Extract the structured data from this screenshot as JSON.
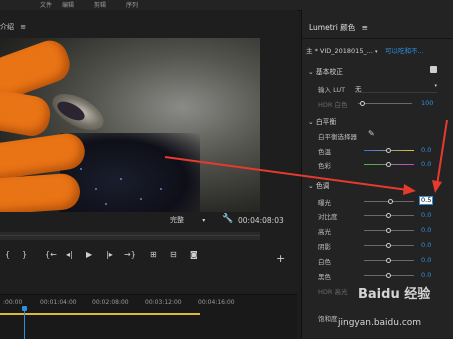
{
  "top_tabs": [
    "文件",
    "编辑",
    "剪辑",
    "序列"
  ],
  "left_panel": {
    "title": "介绍",
    "menu_icon": "hamburger-icon"
  },
  "monitor": {
    "fit_label": "完整",
    "timecode": "00:04:08:03",
    "transport_icons": [
      "mark-in-icon",
      "mark-out-icon",
      "go-to-in-icon",
      "step-back-icon",
      "play-icon",
      "step-forward-icon",
      "go-to-out-icon",
      "insert-icon",
      "overwrite-icon",
      "export-frame-icon"
    ],
    "add_icon": "plus-icon"
  },
  "timeline": {
    "ticks": [
      ":00:00",
      "00:01:04:00",
      "00:02:08:00",
      "00:03:12:00",
      "00:04:16:00"
    ]
  },
  "lumetri": {
    "title": "Lumetri 颜色",
    "source_label": "主 * VID_2018015_...",
    "clip_label": "可以吃和不...",
    "basic_section": "基本校正",
    "input_lut_label": "输入 LUT",
    "input_lut_value": "无",
    "hdr_white_label": "HDR 白色",
    "hdr_white_value": "100",
    "wb_section": "白平衡",
    "wb_picker_label": "白平衡选择器",
    "temperature_label": "色温",
    "temperature_value": "0.0",
    "tint_label": "色彩",
    "tint_value": "0.0",
    "tone_section": "色调",
    "exposure_label": "曝光",
    "exposure_value": "0.5",
    "contrast_label": "对比度",
    "contrast_value": "0.0",
    "highlights_label": "高光",
    "highlights_value": "0.0",
    "shadows_label": "阴影",
    "shadows_value": "0.0",
    "whites_label": "白色",
    "whites_value": "0.0",
    "blacks_label": "黑色",
    "blacks_value": "0.0",
    "hdr_specular_label": "HDR 高光",
    "saturation_label": "饱和度"
  },
  "colors": {
    "accent": "#2f8fdf",
    "annotation_arrow": "#e63a2e",
    "glove": "#e97415"
  },
  "watermark": {
    "logo_text": "Baidu 经验",
    "url": "jingyan.baidu.com"
  }
}
